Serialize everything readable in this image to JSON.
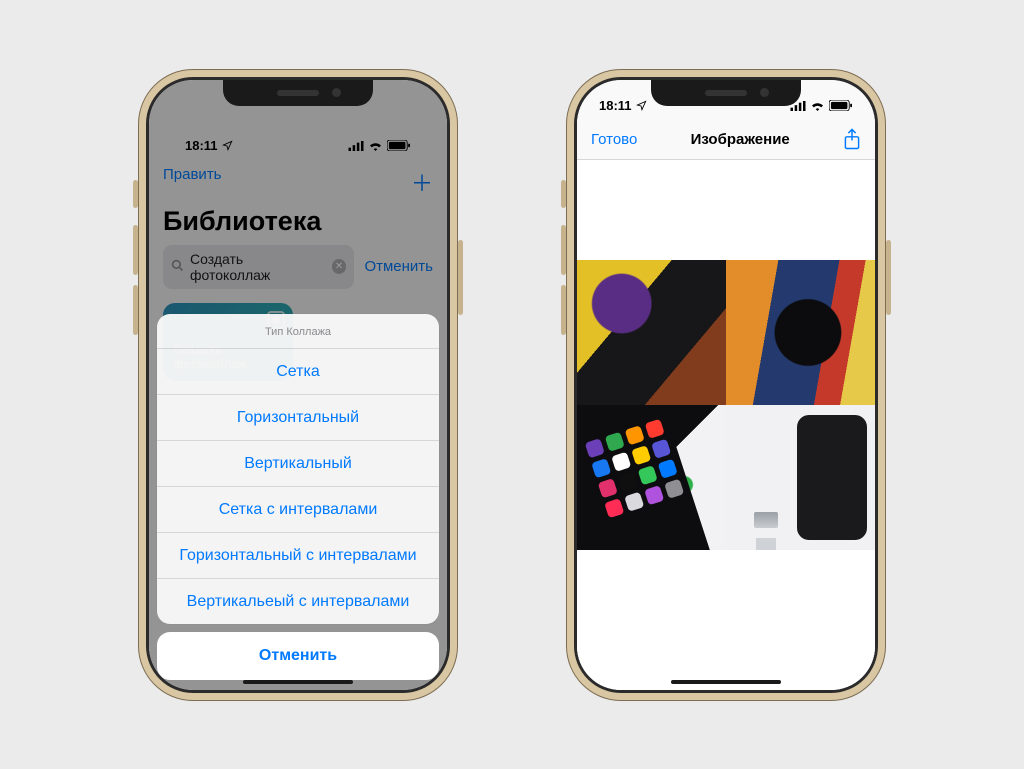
{
  "status": {
    "time": "18:11"
  },
  "left": {
    "nav_edit": "Править",
    "title": "Библиотека",
    "search_value": "Создать фотоколлаж",
    "search_cancel": "Отменить",
    "card_label": "Создать фотоколлаж",
    "sheet": {
      "title": "Тип Коллажа",
      "options": [
        "Сетка",
        "Горизонтальный",
        "Вертикальный",
        "Сетка с интервалами",
        "Горизонтальный с интервалами",
        "Вертикальеый с интервалами"
      ],
      "cancel": "Отменить"
    }
  },
  "right": {
    "done": "Готово",
    "title": "Изображение"
  }
}
